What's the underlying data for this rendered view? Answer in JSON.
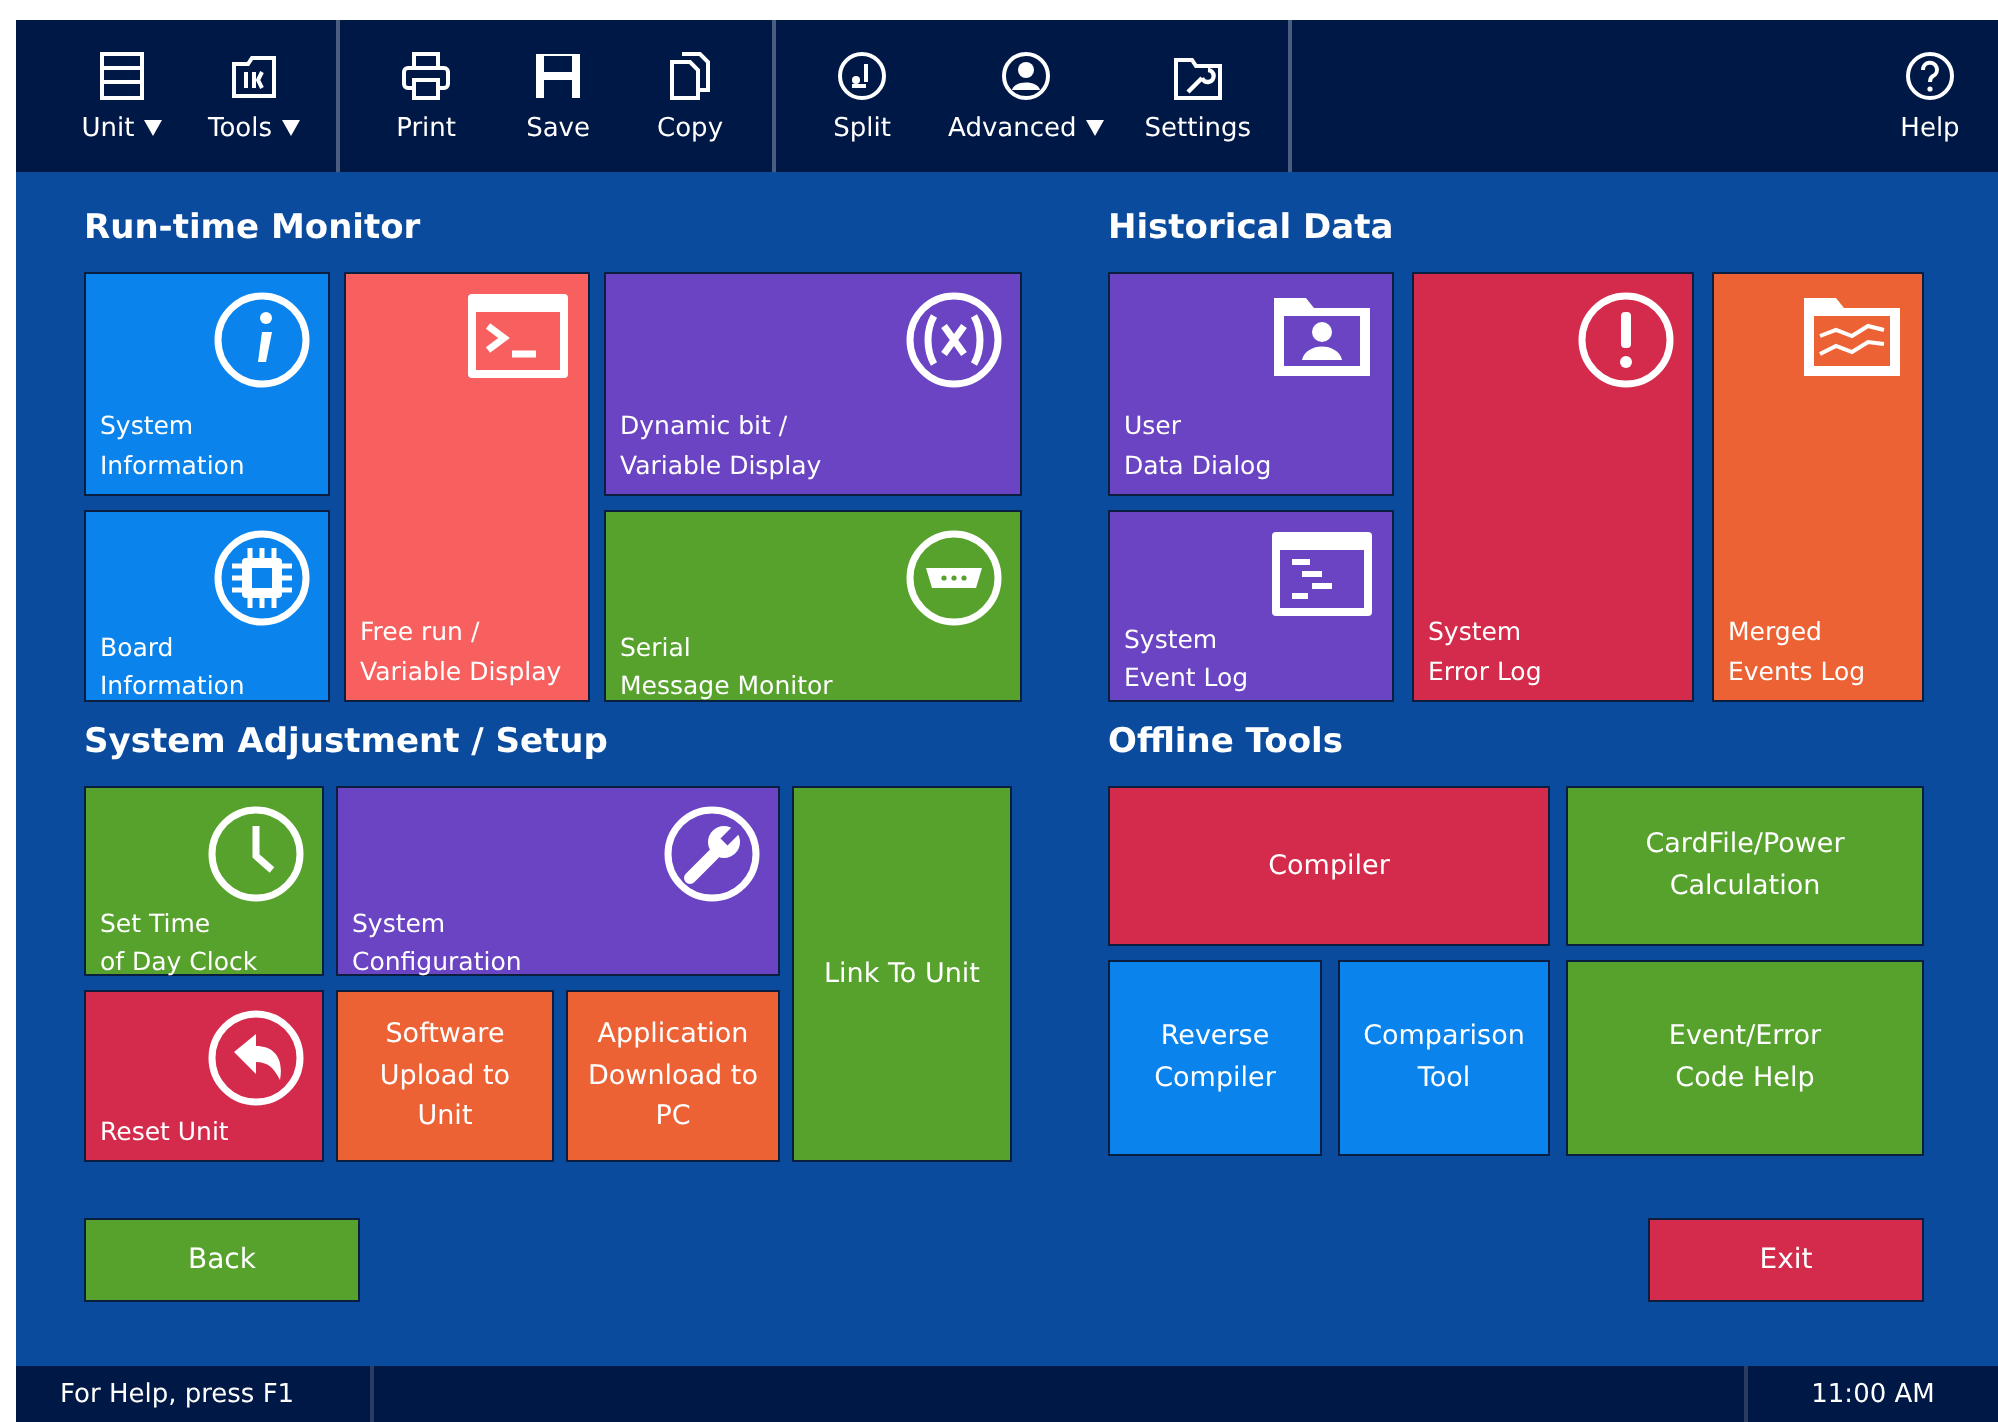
{
  "toolbar": {
    "groups": [
      [
        {
          "label": "Unit",
          "dropdown": true
        },
        {
          "label": "Tools",
          "dropdown": true
        }
      ],
      [
        {
          "label": "Print",
          "dropdown": false
        },
        {
          "label": "Save",
          "dropdown": false
        },
        {
          "label": "Copy",
          "dropdown": false
        }
      ],
      [
        {
          "label": "Split",
          "dropdown": false
        },
        {
          "label": "Advanced",
          "dropdown": true
        },
        {
          "label": "Settings",
          "dropdown": false
        }
      ]
    ],
    "help": {
      "label": "Help"
    }
  },
  "sections": [
    {
      "title": "Run-time Monitor",
      "tiles": [
        {
          "label": "System\nInformation",
          "kind": "icon",
          "color": "#0a84ec"
        },
        {
          "label": "Board\nInformation",
          "kind": "icon",
          "color": "#0a84ec"
        },
        {
          "label": "Free run /\nVariable Display",
          "kind": "icon",
          "color": "#f86060"
        },
        {
          "label": "Dynamic bit /\nVariable Display",
          "kind": "icon",
          "color": "#6a44c2"
        },
        {
          "label": "Serial\nMessage Monitor",
          "kind": "icon",
          "color": "#56a22c"
        }
      ]
    },
    {
      "title": "Historical Data",
      "tiles": [
        {
          "label": "User\nData Dialog",
          "kind": "icon",
          "color": "#6a44c2"
        },
        {
          "label": "System\nEvent Log",
          "kind": "icon",
          "color": "#6a44c2"
        },
        {
          "label": "System\nError Log",
          "kind": "icon",
          "color": "#d42b4c"
        },
        {
          "label": "Merged\nEvents Log",
          "kind": "icon",
          "color": "#ec6234"
        }
      ]
    },
    {
      "title": "System Adjustment / Setup",
      "tiles": [
        {
          "label": "Set Time\nof Day Clock",
          "kind": "icon",
          "color": "#56a22c"
        },
        {
          "label": "System\nConfiguration",
          "kind": "icon",
          "color": "#6a44c2"
        },
        {
          "label": "Link To Unit",
          "kind": "text",
          "color": "#56a22c"
        },
        {
          "label": "Reset Unit",
          "kind": "icon",
          "color": "#d42b4c"
        },
        {
          "label": "Software\nUpload to\nUnit",
          "kind": "text",
          "color": "#ec6234"
        },
        {
          "label": "Application\nDownload to\nPC",
          "kind": "text",
          "color": "#ec6234"
        }
      ]
    },
    {
      "title": "Offline Tools",
      "tiles": [
        {
          "label": "Compiler",
          "kind": "text",
          "color": "#d42b4c"
        },
        {
          "label": "CardFile/Power\nCalculation",
          "kind": "text",
          "color": "#56a22c"
        },
        {
          "label": "Reverse\nCompiler",
          "kind": "text",
          "color": "#0a84ec"
        },
        {
          "label": "Comparison\nTool",
          "kind": "text",
          "color": "#0a84ec"
        },
        {
          "label": "Event/Error\nCode Help",
          "kind": "text",
          "color": "#56a22c"
        }
      ]
    }
  ],
  "bottom_buttons": [
    {
      "label": "Back",
      "color": "#56a22c"
    },
    {
      "label": "Exit",
      "color": "#d42b4c"
    }
  ],
  "status_bar": {
    "hint": "For Help, press F1",
    "time": "11:00 AM"
  }
}
